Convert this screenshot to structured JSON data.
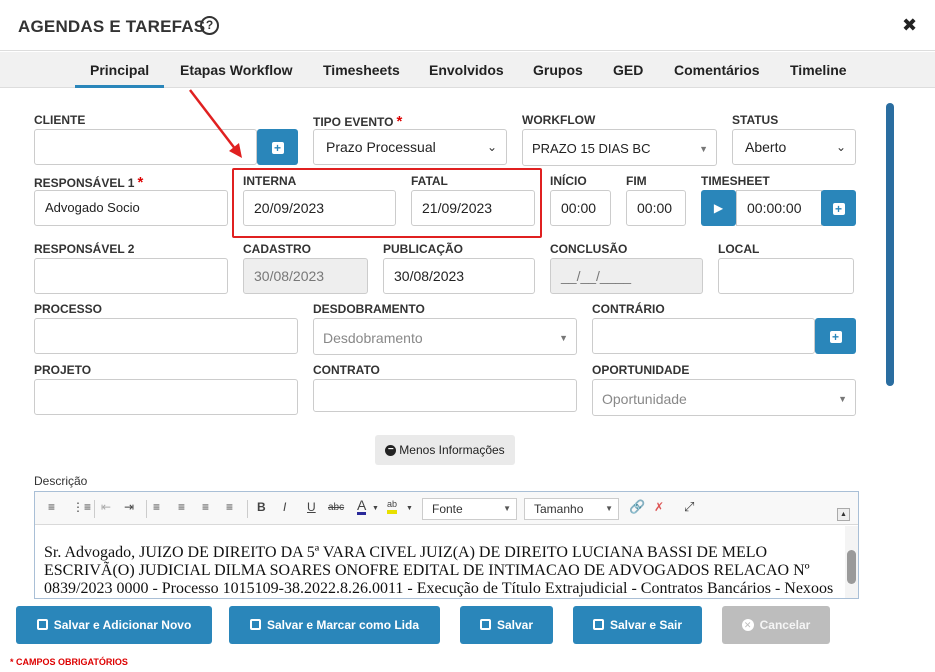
{
  "header": {
    "title": "AGENDAS E TAREFAS",
    "help_icon": "?",
    "close_icon": "✖"
  },
  "tabs": [
    {
      "label": "Principal",
      "active": true
    },
    {
      "label": "Etapas Workflow"
    },
    {
      "label": "Timesheets"
    },
    {
      "label": "Envolvidos"
    },
    {
      "label": "Grupos"
    },
    {
      "label": "GED"
    },
    {
      "label": "Comentários"
    },
    {
      "label": "Timeline"
    }
  ],
  "form": {
    "cliente": {
      "label": "CLIENTE",
      "value": ""
    },
    "tipo_evento": {
      "label": "TIPO EVENTO",
      "value": "Prazo Processual"
    },
    "workflow": {
      "label": "WORKFLOW",
      "value": "PRAZO 15 DIAS BC"
    },
    "status": {
      "label": "STATUS",
      "value": "Aberto"
    },
    "responsavel1": {
      "label": "RESPONSÁVEL 1",
      "value": "Advogado Socio"
    },
    "interna": {
      "label": "INTERNA",
      "value": "20/09/2023"
    },
    "fatal": {
      "label": "FATAL",
      "value": "21/09/2023"
    },
    "inicio": {
      "label": "INÍCIO",
      "value": "00:00"
    },
    "fim": {
      "label": "FIM",
      "value": "00:00"
    },
    "timesheet": {
      "label": "TIMESHEET",
      "value": "00:00:00"
    },
    "responsavel2": {
      "label": "RESPONSÁVEL 2",
      "value": ""
    },
    "cadastro": {
      "label": "CADASTRO",
      "value": "30/08/2023"
    },
    "publicacao": {
      "label": "PUBLICAÇÃO",
      "value": "30/08/2023"
    },
    "conclusao": {
      "label": "CONCLUSÃO",
      "value": "__/__/____"
    },
    "local": {
      "label": "LOCAL",
      "value": ""
    },
    "processo": {
      "label": "PROCESSO",
      "value": ""
    },
    "desdobramento": {
      "label": "DESDOBRAMENTO",
      "placeholder": "Desdobramento"
    },
    "contrario": {
      "label": "CONTRÁRIO",
      "value": ""
    },
    "projeto": {
      "label": "PROJETO",
      "value": ""
    },
    "contrato": {
      "label": "CONTRATO",
      "value": ""
    },
    "oportunidade": {
      "label": "OPORTUNIDADE",
      "placeholder": "Oportunidade"
    },
    "required_mark": "*"
  },
  "menos_info": "Menos Informações",
  "descricao": {
    "label": "Descrição",
    "font_combo": "Fonte",
    "size_combo": "Tamanho",
    "text": "Sr. Advogado, JUIZO DE DIREITO DA 5ª VARA CIVEL JUIZ(A) DE DIREITO LUCIANA BASSI DE MELO ESCRIVÃ(O) JUDICIAL DILMA SOARES ONOFRE EDITAL DE INTIMACAO DE ADVOGADOS RELACAO Nº 0839/2023 0000 - Processo 1015109-38.2022.8.26.0011 - Execução de Título Extrajudicial - Contratos Bancários - Nexoos"
  },
  "footer": {
    "buttons": [
      "Salvar e Adicionar Novo",
      "Salvar e Marcar como Lida",
      "Salvar",
      "Salvar e Sair",
      "Cancelar"
    ],
    "required_note": "* CAMPOS OBRIGATÓRIOS"
  },
  "colors": {
    "primary": "#2a86ba",
    "highlight_box": "#e02020",
    "disabled": "#bdbdbd"
  }
}
